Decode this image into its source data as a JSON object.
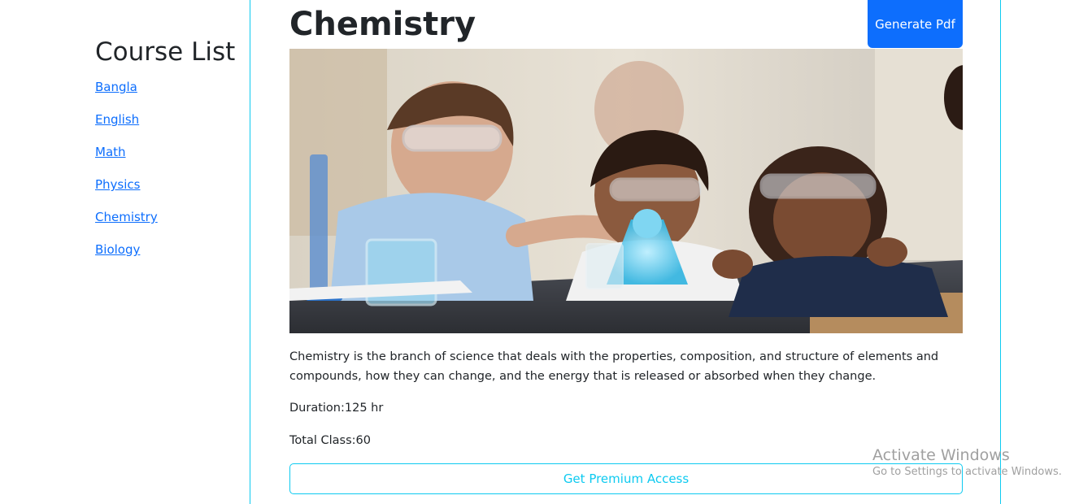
{
  "sidebar": {
    "title": "Course List",
    "items": [
      {
        "label": "Bangla"
      },
      {
        "label": "English"
      },
      {
        "label": "Math"
      },
      {
        "label": "Physics"
      },
      {
        "label": "Chemistry"
      },
      {
        "label": "Biology"
      }
    ]
  },
  "course": {
    "title": "Chemistry",
    "pdf_button": "Generate Pdf",
    "description": "Chemistry is the branch of science that deals with the properties, composition, and structure of elements and compounds, how they can change, and the energy that is released or absorbed when they change.",
    "duration": "Duration:125 hr",
    "total_class": "Total Class:60",
    "premium_button": "Get Premium Access"
  },
  "watermark": {
    "title": "Activate Windows",
    "subtitle": "Go to Settings to activate Windows."
  },
  "colors": {
    "primary": "#0d6efd",
    "info": "#0dcaf0",
    "text": "#212529"
  }
}
